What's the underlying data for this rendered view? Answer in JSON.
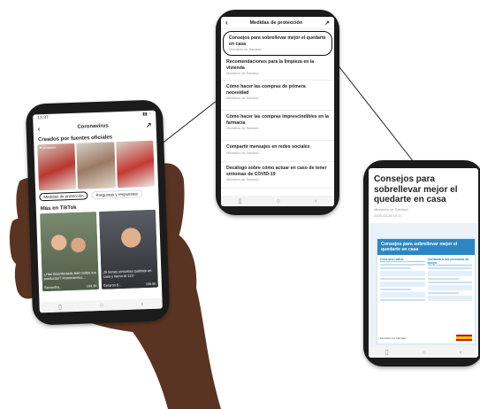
{
  "phone_left": {
    "status_time": "13:37",
    "header_title": "Coronavirus",
    "section_official": "Creados por fuentes oficiales",
    "thumb_caption": "❤ Ministerio",
    "chip_protection": "Medidas de protección",
    "chip_questions": "Preguntas y respuestas",
    "section_tiktok": "Más en TikTok",
    "video1_caption": "¿Has desinfectado bien todos tus productos? #coronavirus...",
    "video1_user": "Samantha...",
    "video1_likes": "104.3K",
    "video2_caption": "¡Si tienes síntomas quédate en casa y llama al 112!",
    "video2_user": "Gerardo B...",
    "video2_likes": "158.8K"
  },
  "phone_middle": {
    "header_title": "Medidas de protección",
    "items": [
      {
        "title": "Consejos para sobrellevar mejor el quedarte en casa",
        "source": "Ministerio de Sanidad"
      },
      {
        "title": "Recomendaciones para la limpieza en la vivienda",
        "source": "Ministerio de Sanidad"
      },
      {
        "title": "Cómo hacer las compras de primera necesidad",
        "source": "Ministerio de Sanidad"
      },
      {
        "title": "Cómo hacer las compras imprescindibles en la farmacia",
        "source": "Ministerio de Sanidad"
      },
      {
        "title": "Compartir mensajes en redes sociales",
        "source": "Ministerio de Sanidad"
      },
      {
        "title": "Decálogo sobre cómo actuar en caso de tener síntomas de COVID-19",
        "source": "Ministerio de Sanidad"
      }
    ]
  },
  "phone_right": {
    "title": "Consejos para sobrellevar mejor el quedarte en casa",
    "source": "Ministerio de Sanidad",
    "date": "2020-03-26 19:17",
    "doc_heading": "Consejos para sobrellevar mejor el quedarte en casa",
    "doc_col1": "Crea una rutina",
    "doc_col2": "Contacta a tus personas de apoyo",
    "doc_footer": "Ministerio de Sanidad"
  },
  "colors": {
    "accent": "#2b86c4",
    "frame": "#1b1b1b",
    "skin": "#5a3422"
  }
}
